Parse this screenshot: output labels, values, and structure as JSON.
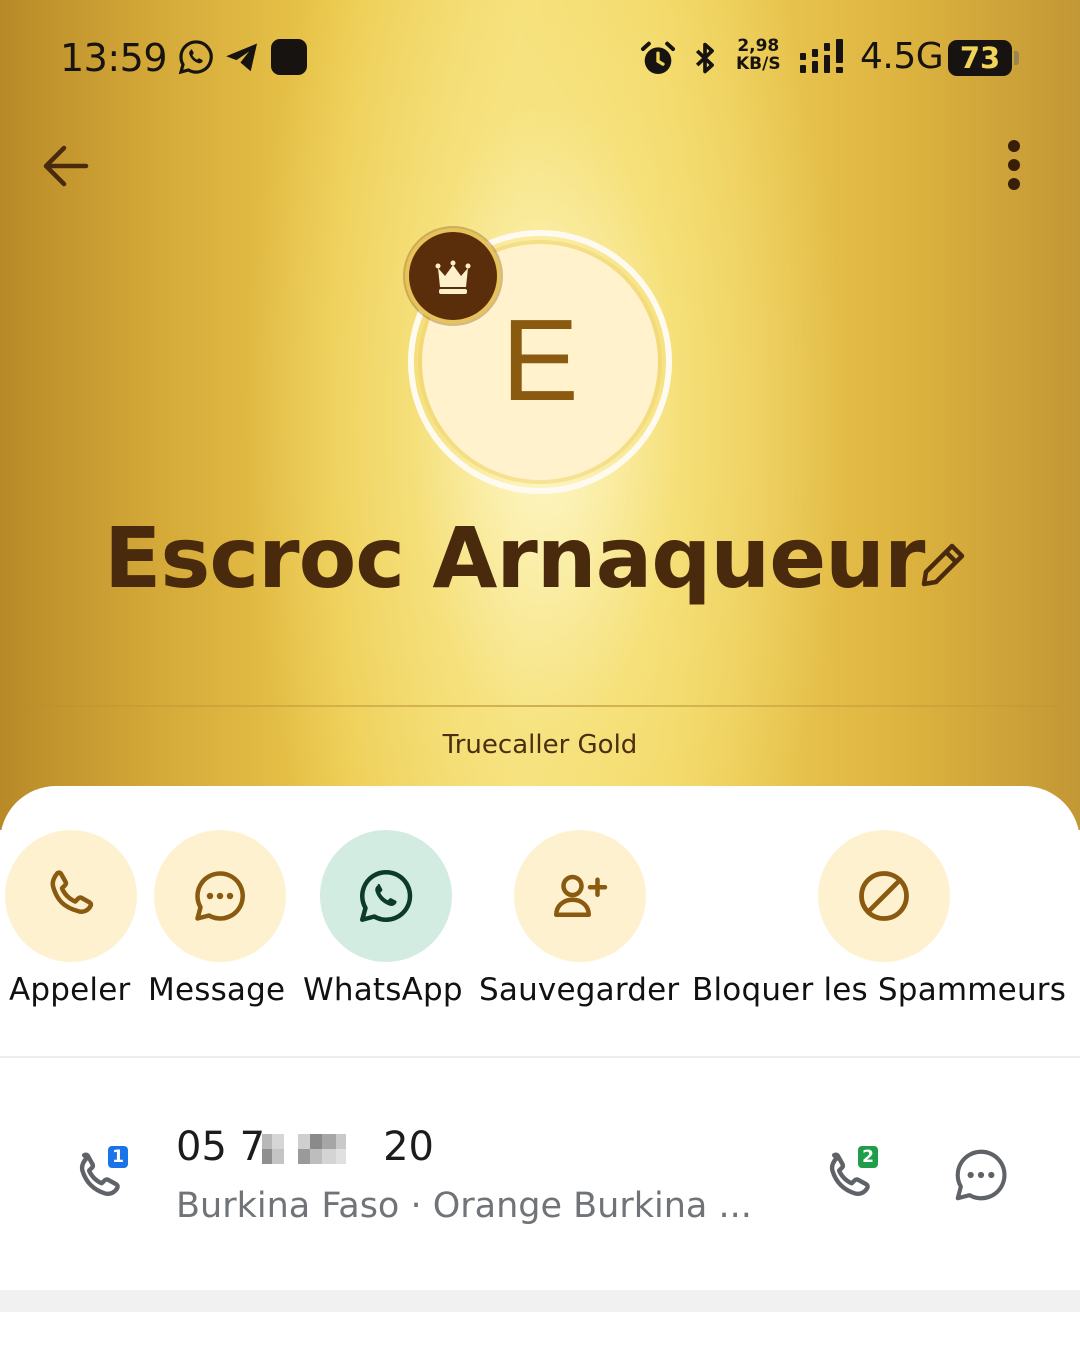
{
  "status_bar": {
    "time": "13:59",
    "speed_value": "2,98",
    "speed_unit": "KB/S",
    "network": "4.5G",
    "battery": "73",
    "icons": [
      "whatsapp-icon",
      "telegram-icon",
      "app-icon",
      "alarm-icon",
      "bluetooth-icon",
      "signal-icon"
    ]
  },
  "toolbar": {
    "back_icon": "arrow-left-icon",
    "more_icon": "more-vertical-icon"
  },
  "profile": {
    "avatar_letter": "E",
    "badge_icon": "crown-icon",
    "name": "Escroc Arnaqueur",
    "edit_icon": "pencil-icon",
    "tier": "Truecaller Gold"
  },
  "actions": [
    {
      "label": "Appeler",
      "icon": "phone-icon"
    },
    {
      "label": "Message",
      "icon": "message-icon"
    },
    {
      "label": "WhatsApp",
      "icon": "whatsapp-icon"
    },
    {
      "label": "Sauvegarder",
      "icon": "add-contact-icon"
    },
    {
      "label": "Bloquer les Spammeurs",
      "icon": "block-icon"
    }
  ],
  "number_row": {
    "number_start": "05 7",
    "number_end": "20",
    "carrier": "Burkina Faso · Orange Burkina ...",
    "sim1_label": "1",
    "sim2_label": "2"
  },
  "colors": {
    "gold_accent": "#e9c24f",
    "brown_text": "#4a2a0c",
    "action_bg": "#fdf1cf",
    "whatsapp_bg": "#d2ece2",
    "sim1": "#1a73e8",
    "sim2": "#1e9e4a"
  }
}
